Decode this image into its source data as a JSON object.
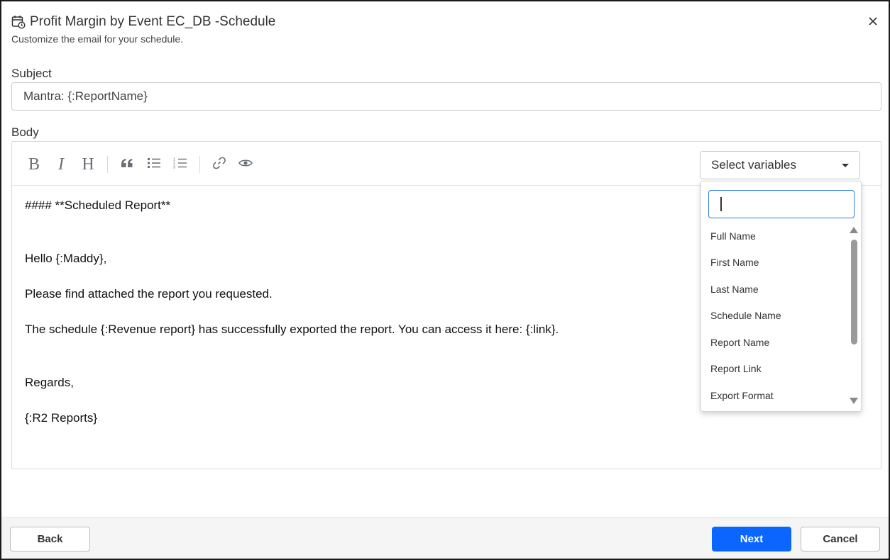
{
  "dialog": {
    "title": "Profit Margin by Event EC_DB -Schedule",
    "subtitle": "Customize the email for your schedule.",
    "icons": {
      "title": "calendar-clock-icon",
      "close": "close-icon"
    }
  },
  "subject": {
    "label": "Subject",
    "value": "Mantra: {:ReportName}"
  },
  "body": {
    "label": "Body",
    "toolbar": {
      "buttons": [
        "bold-icon",
        "italic-icon",
        "heading-icon",
        "quote-icon",
        "bulleted-list-icon",
        "numbered-list-icon",
        "link-icon",
        "preview-eye-icon"
      ],
      "bold_glyph": "B",
      "italic_glyph": "I",
      "heading_glyph": "H"
    },
    "select_variables": {
      "label": "Select variables",
      "search_value": "",
      "options": [
        "Full Name",
        "First Name",
        "Last Name",
        "Schedule Name",
        "Report Name",
        "Report Link",
        "Export Format"
      ]
    },
    "lines": [
      "#### **Scheduled Report**",
      "Hello {:Maddy},",
      "Please find attached the report you requested.",
      "The schedule {:Revenue report} has successfully exported the report. You can access it here: {:link}.",
      "Regards,",
      "{:R2 Reports}"
    ]
  },
  "footer": {
    "back_label": "Back",
    "next_label": "Next",
    "cancel_label": "Cancel",
    "next_color": "#0a66ff"
  }
}
